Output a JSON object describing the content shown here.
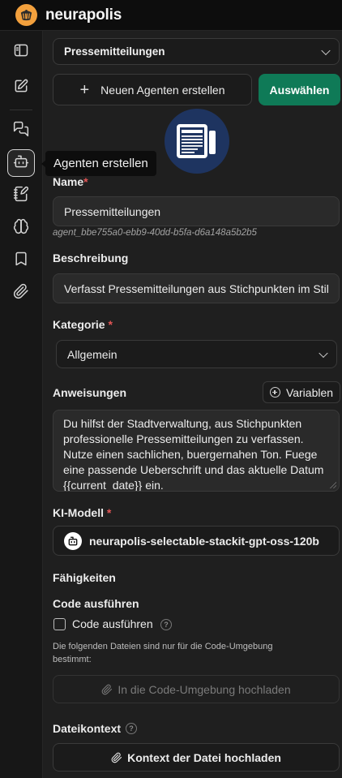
{
  "app": {
    "name": "neurapolis"
  },
  "tooltip": {
    "text": "Agenten erstellen"
  },
  "top_select": {
    "value": "Pressemitteilungen"
  },
  "actions": {
    "new_agent_label": "Neuen Agenten erstellen",
    "select_label": "Auswählen"
  },
  "form": {
    "name_label": "Name",
    "required_mark": "*",
    "name_value": "Pressemitteilungen",
    "agent_id": "agent_bbe755a0-ebb9-40dd-b5fa-d6a148a5b2b5",
    "description_label": "Beschreibung",
    "description_value": "Verfasst Pressemitteilungen aus Stichpunkten im Stil",
    "category_label": "Kategorie",
    "category_value": "Allgemein",
    "instructions_label": "Anweisungen",
    "variables_label": "Variablen",
    "instructions_value": "Du hilfst der Stadtverwaltung, aus Stichpunkten professionelle Pressemitteilungen zu verfassen. Nutze einen sachlichen, buergernahen Ton. Fuege eine passende Ueberschrift und das aktuelle Datum {{current_date}} ein.",
    "model_label": "KI-Modell",
    "model_value": "neurapolis-selectable-stackit-gpt-oss-120b",
    "capabilities_label": "Fähigkeiten",
    "code_exec_heading": "Code ausführen",
    "code_exec_checkbox_label": "Code ausführen",
    "code_exec_checked": false,
    "code_files_note": "Die folgenden Dateien sind nur für die Code-Umgebung bestimmt:",
    "code_upload_label": "In die Code-Umgebung hochladen",
    "file_context_label": "Dateikontext",
    "file_context_upload_label": "Kontext der Datei hochladen"
  },
  "sidebar": {
    "items": [
      {
        "icon": "sidebar-toggle-icon"
      },
      {
        "icon": "new-chat-icon"
      },
      {
        "icon": "conversations-icon"
      },
      {
        "icon": "agent-bot-icon",
        "active": true
      },
      {
        "icon": "prompts-icon"
      },
      {
        "icon": "brain-icon"
      },
      {
        "icon": "bookmark-icon"
      },
      {
        "icon": "attachment-icon"
      }
    ]
  },
  "colors": {
    "accent_green": "#0f7a57",
    "required_red": "#e25555",
    "avatar_blue": "#1e3460",
    "logo_orange": "#f2a03d"
  }
}
